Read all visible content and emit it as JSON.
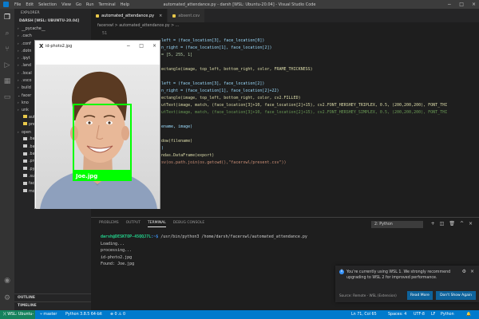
{
  "window": {
    "title": "automated_attendance.py - darsh [WSL: Ubuntu-20.04] - Visual Studio Code",
    "menu": [
      "File",
      "Edit",
      "Selection",
      "View",
      "Go",
      "Run",
      "Terminal",
      "Help"
    ],
    "controls": [
      "−",
      "□",
      "×"
    ]
  },
  "activity_icons": [
    "files-icon",
    "search-icon",
    "source-control-icon",
    "run-debug-icon",
    "extensions-icon",
    "remote-explorer-icon",
    "account-icon",
    "settings-gear-icon"
  ],
  "sidebar": {
    "header": "EXPLORER",
    "workspace": "DARSH [WSL: UBUNTU-20.04]",
    "items": [
      {
        "label": "__pycache__",
        "chevron": "›",
        "color": "#cccccc"
      },
      {
        "label": ".cach",
        "chevron": "›",
        "color": "#cccccc"
      },
      {
        "label": ".conf",
        "chevron": "›",
        "color": "#cccccc"
      },
      {
        "label": ".dotn",
        "chevron": "›",
        "color": "#cccccc"
      },
      {
        "label": ".ipyt",
        "chevron": "›",
        "color": "#cccccc"
      },
      {
        "label": ".land",
        "chevron": "›",
        "color": "#cccccc"
      },
      {
        "label": ".local",
        "chevron": "›",
        "color": "#cccccc"
      },
      {
        "label": ".vsco",
        "chevron": "›",
        "color": "#cccccc"
      },
      {
        "label": "build",
        "chevron": "›",
        "color": "#cccccc"
      },
      {
        "label": "facer",
        "chevron": "⌄",
        "color": "#cccccc"
      },
      {
        "label": "kno",
        "chevron": "›",
        "color": "#cccccc"
      },
      {
        "label": "unk",
        "chevron": "›",
        "color": "#cccccc"
      },
      {
        "label": "aut",
        "chevron": "",
        "color": "#e8c84a"
      },
      {
        "label": "pre",
        "chevron": "",
        "color": "#e8c84a"
      },
      {
        "label": "open",
        "chevron": "›",
        "color": "#cccccc"
      },
      {
        "label": ".bash",
        "chevron": "",
        "color": "#cccccc"
      },
      {
        "label": ".bash",
        "chevron": "",
        "color": "#cccccc"
      },
      {
        "label": ".bash",
        "chevron": "",
        "color": "#cccccc"
      },
      {
        "label": ".profi",
        "chevron": "",
        "color": "#cccccc"
      },
      {
        "label": ".python_history",
        "chevron": "",
        "color": "#cccccc"
      },
      {
        "label": ".sudo_as_admin_successful",
        "chevron": "",
        "color": "#cccccc"
      },
      {
        "label": "facenet.spec",
        "chevron": "",
        "color": "#cccccc"
      },
      {
        "label": "mocp_server.log",
        "chevron": "",
        "color": "#cccccc"
      }
    ],
    "outline": "OUTLINE",
    "timeline": "TIMELINE"
  },
  "editor": {
    "tabs": [
      {
        "label": "automated_attendance.py",
        "active": true
      },
      {
        "label": "absent.csv",
        "active": false
      }
    ],
    "breadcrumb": "facerxwl > automated_attendance.py > ...",
    "first_line_number": "51",
    "lines": [
      {
        "n": "",
        "t": "left = (face_location[3], face_location[0])",
        "c": "kw"
      },
      {
        "n": "",
        "t": "n_right = (face_location[1], face_location[2])",
        "c": "kw"
      },
      {
        "n": "",
        "t": "= [5, 255, 1]",
        "c": "num"
      },
      {
        "n": "",
        "t": "",
        "c": "kw"
      },
      {
        "n": "",
        "t": "ectangle(image, top_left, bottom_right, color, FRAME_THICKNESS)",
        "c": "fn"
      },
      {
        "n": "",
        "t": "",
        "c": "kw"
      },
      {
        "n": "",
        "t": "left = (face_location[3], face_location[2])",
        "c": "kw"
      },
      {
        "n": "",
        "t": "n_right = (face_location[1], face_location[2]+22)",
        "c": "kw"
      },
      {
        "n": "",
        "t": "ectangle(image, top_left, bottom_right, color, cv2.FILLED)",
        "c": "fn"
      },
      {
        "n": "",
        "t": "utText(image, match, (face_location[3]+10, face_location[2]+15), cv2.FONT_HERSHEY_TRIPLEX, 0.5, (200,200,200), FONT_THI",
        "c": "fn"
      },
      {
        "n": "",
        "t": "utText(image, match, (face_location[3]+10, face_location[2]+15), cv2.FONT_HERSHEY_SIMPLEX, 0.5, (200,200,200), FONT_THI",
        "c": "cm"
      },
      {
        "n": "",
        "t": "",
        "c": "kw"
      },
      {
        "n": "",
        "t": "ename, image)",
        "c": "kw"
      },
      {
        "n": "",
        "t": "",
        "c": "kw"
      },
      {
        "n": "",
        "t": "dow(filename)",
        "c": "fn"
      },
      {
        "n": "",
        "t": ")",
        "c": "kw"
      },
      {
        "n": "",
        "t": "ndas.DataFrame(export)",
        "c": "fn"
      },
      {
        "n": "",
        "t": "sv(os.path.join(os.getcwd(),\"facerxwl/present.csv\"))",
        "c": "str"
      }
    ]
  },
  "image_window": {
    "title": "id-photo2.jpg",
    "logo": "X",
    "label": "Joe.jpg",
    "box_color": "#00ff00"
  },
  "panel": {
    "tabs": [
      "PROBLEMS",
      "OUTPUT",
      "TERMINAL",
      "DEBUG CONSOLE"
    ],
    "active_tab": "TERMINAL",
    "terminal_select": "2: Python",
    "prompt_user": "darsh@DESKTOP-45QQJ7L",
    "prompt_path": ":~$",
    "command": " /usr/bin/python3 /home/darsh/facerxwl/automated_attendance.py",
    "output": [
      "Loading...",
      "processing...",
      "id-photo2.jpg",
      "Found: Joe.jpg"
    ]
  },
  "notification": {
    "message": "You're currently using WSL 1. We strongly recommend upgrading to WSL 2 for improved performance.",
    "source": "Source: Remote - WSL (Extension)",
    "read_more": "Read More",
    "dont_show": "Don't Show Again"
  },
  "statusbar": {
    "remote": "WSL: Ubuntu-20.04",
    "branch": "master",
    "python": "Python 3.8.5 64-bit",
    "errors": "0",
    "warnings": "0",
    "position": "Ln 71, Col 65",
    "spaces": "Spaces: 4",
    "encoding": "UTF-8",
    "eol": "LF",
    "language": "Python"
  }
}
